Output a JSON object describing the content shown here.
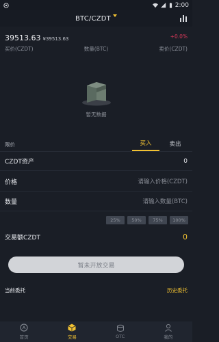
{
  "status": {
    "time": "2:00"
  },
  "header": {
    "pair": "BTC/CZDT"
  },
  "ticker": {
    "price": "39513.63",
    "price_fiat": "¥39513.63",
    "change": "+0.0%"
  },
  "orderbook": {
    "bid_col": "买价(CZDT)",
    "qty_col": "数量(BTC)",
    "ask_col": "卖价(CZDT)"
  },
  "empty_state": {
    "label": "暂无数据"
  },
  "trade": {
    "order_type": "限价",
    "tab_buy": "买入",
    "tab_sell": "卖出",
    "asset_label": "CZDT资产",
    "asset_value": "0",
    "price_label": "价格",
    "price_placeholder": "请输入价格(CZDT)",
    "qty_label": "数量",
    "qty_placeholder": "请输入数量(BTC)",
    "percents": [
      "25%",
      "50%",
      "75%",
      "100%"
    ],
    "amount_label": "交易额CZDT",
    "amount_value": "0",
    "submit_label": "暂未开放交易"
  },
  "orders": {
    "current": "当前委托",
    "history": "历史委托"
  },
  "nav": {
    "items": [
      "首页",
      "交易",
      "OTC",
      "我的"
    ],
    "active_index": 1
  },
  "colors": {
    "accent": "#f2c232",
    "negative_change": "#e0395b",
    "background": "#1a1e26"
  }
}
